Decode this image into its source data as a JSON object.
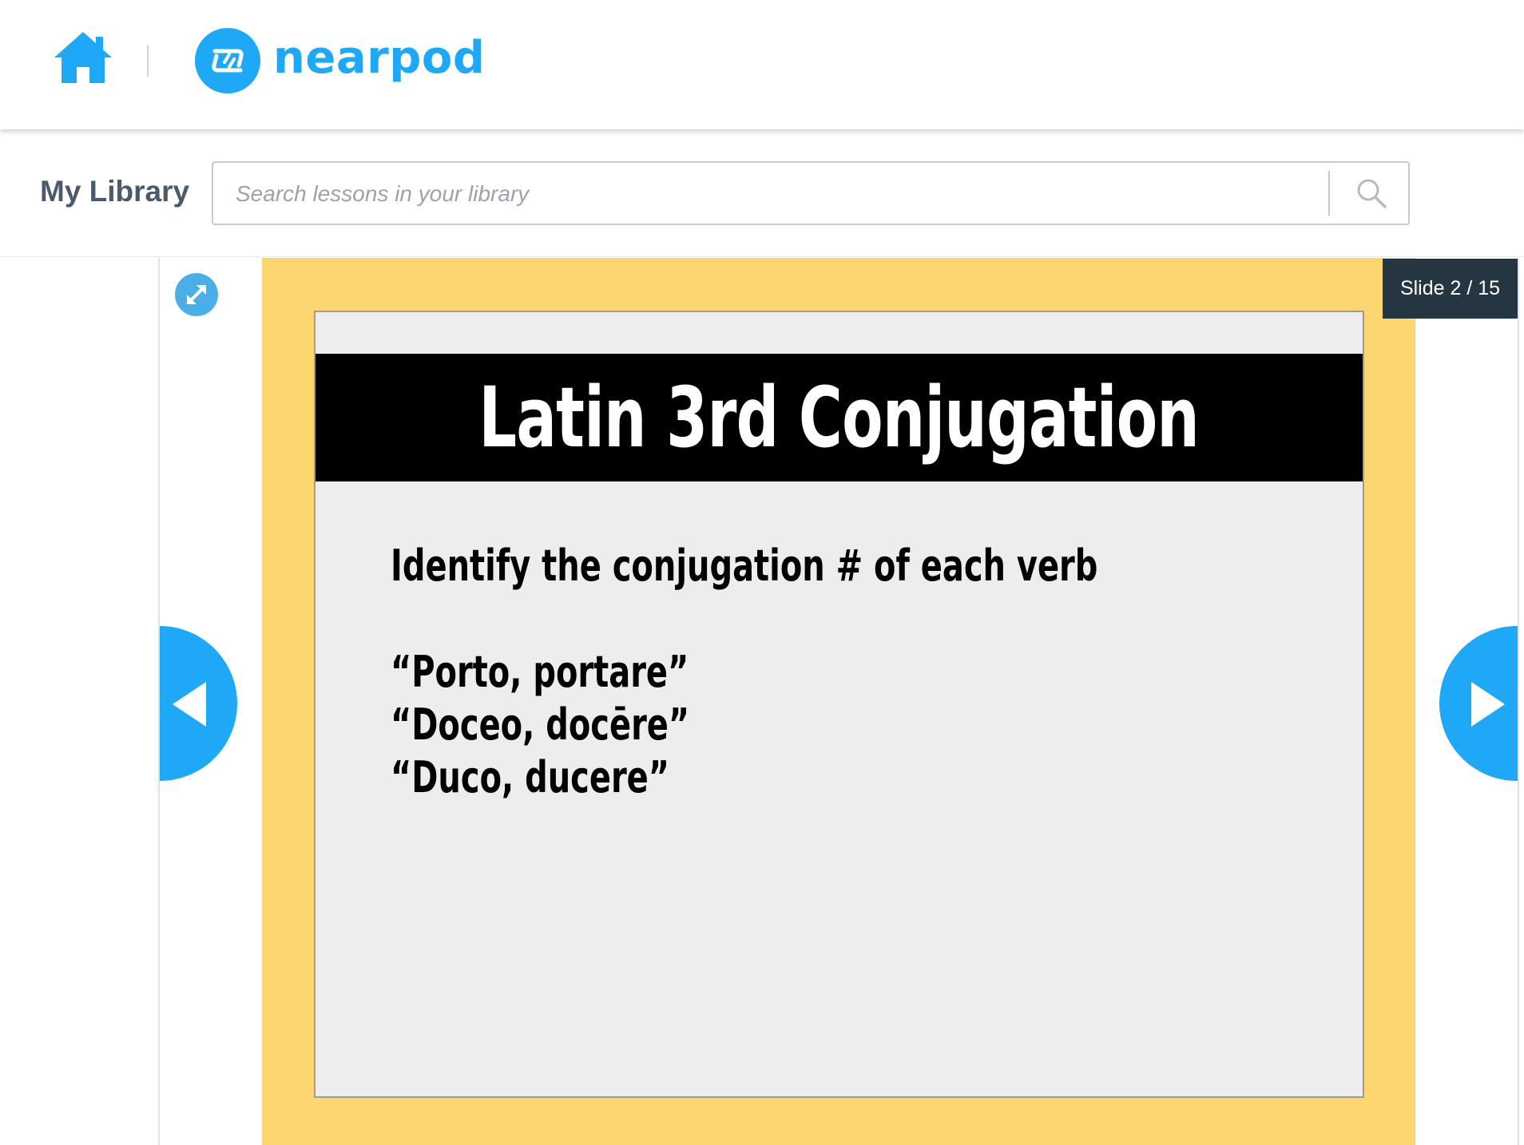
{
  "header": {
    "home_icon": "home-icon",
    "logo_icon": "nearpod-logo-icon",
    "logo_text": "nearpod"
  },
  "library": {
    "title": "My Library",
    "search": {
      "placeholder": "Search lessons in your library",
      "value": "",
      "icon": "search-icon"
    }
  },
  "viewer": {
    "expand_icon": "expand-icon",
    "prev_icon": "triangle-left-icon",
    "next_icon": "triangle-right-icon",
    "counter": "Slide 2 / 15",
    "slide": {
      "title": "Latin 3rd Conjugation",
      "instruction": "Identify the conjugation # of each verb",
      "verbs": [
        "“Porto, portare”",
        "“Doceo, docēre”",
        "“Duco, ducere”"
      ]
    }
  },
  "colors": {
    "brand_blue": "#1ea8f5",
    "slide_frame_yellow": "#fcd670",
    "counter_bg": "#253642",
    "title_band": "#000000"
  }
}
